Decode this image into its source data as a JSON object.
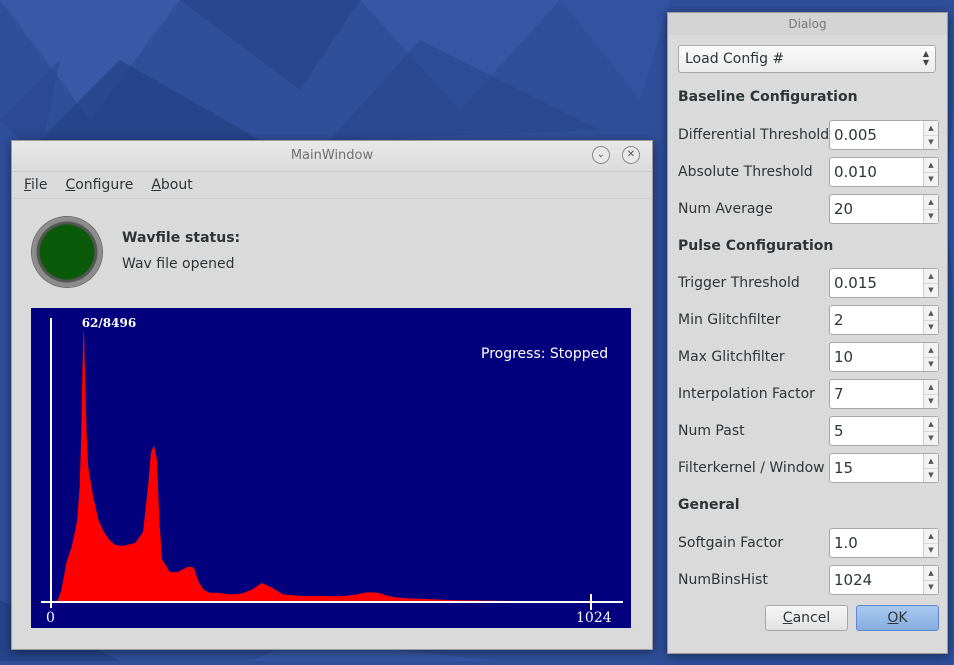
{
  "main_window": {
    "title": "MainWindow",
    "menu": [
      {
        "mnemonic": "F",
        "rest": "ile"
      },
      {
        "mnemonic": "C",
        "rest": "onfigure"
      },
      {
        "mnemonic": "A",
        "rest": "bout"
      }
    ],
    "status_heading": "Wavfile status:",
    "status_text": "Wav file opened",
    "led_color": "#0a5a0a",
    "plot": {
      "background": "#03007e",
      "fill": "#ff0000",
      "peak_label": "62/8496",
      "progress": "Progress: Stopped",
      "x_start_label": "0",
      "x_end_label": "1024"
    }
  },
  "chart_data": {
    "type": "area",
    "title": "",
    "xlabel": "",
    "ylabel": "",
    "xlim": [
      0,
      1024
    ],
    "ylim": [
      0,
      8496
    ],
    "peak": {
      "x": 62,
      "y": 8496
    },
    "x": [
      0,
      12,
      20,
      30,
      40,
      50,
      55,
      58,
      60,
      62,
      64,
      67,
      70,
      80,
      90,
      100,
      110,
      120,
      135,
      160,
      175,
      185,
      190,
      195,
      200,
      205,
      210,
      225,
      240,
      260,
      270,
      280,
      290,
      300,
      315,
      340,
      360,
      380,
      400,
      420,
      440,
      460,
      480,
      500,
      520,
      540,
      560,
      580,
      600,
      620,
      640,
      660,
      680,
      700,
      720,
      740,
      760,
      780,
      800,
      820,
      840,
      860,
      880,
      900,
      920,
      940,
      960,
      980,
      1000,
      1024
    ],
    "y": [
      0,
      0,
      350,
      1250,
      1750,
      2550,
      3650,
      5300,
      7100,
      8496,
      7100,
      5300,
      4250,
      3250,
      2550,
      2200,
      1950,
      1800,
      1750,
      1850,
      2200,
      3700,
      4700,
      4900,
      4500,
      2550,
      1350,
      930,
      930,
      1100,
      1080,
      600,
      370,
      280,
      280,
      230,
      250,
      370,
      590,
      430,
      230,
      200,
      175,
      175,
      180,
      170,
      185,
      230,
      300,
      280,
      175,
      130,
      100,
      90,
      75,
      65,
      50,
      45,
      40,
      35,
      30,
      25,
      20,
      18,
      15,
      12,
      10,
      8,
      5,
      0
    ]
  },
  "dialog": {
    "title": "Dialog",
    "select_value": "Load Config #",
    "sections": {
      "baseline": "Baseline Configuration",
      "pulse": "Pulse Configuration",
      "general": "General"
    },
    "fields": {
      "differential_threshold": {
        "label": "Differential Threshold",
        "value": "0.005"
      },
      "absolute_threshold": {
        "label": "Absolute Threshold",
        "value": "0.010"
      },
      "num_average": {
        "label": "Num Average",
        "value": "20"
      },
      "trigger_threshold": {
        "label": "Trigger Threshold",
        "value": "0.015"
      },
      "min_glitchfilter": {
        "label": "Min Glitchfilter",
        "value": "2"
      },
      "max_glitchfilter": {
        "label": "Max Glitchfilter",
        "value": "10"
      },
      "interpolation_factor": {
        "label": "Interpolation Factor",
        "value": "7"
      },
      "num_past": {
        "label": "Num Past",
        "value": "5"
      },
      "filterkernel_window": {
        "label": "Filterkernel / Window",
        "value": "15"
      },
      "softgain_factor": {
        "label": "Softgain Factor",
        "value": "1.0"
      },
      "numbinshist": {
        "label": "NumBinsHist",
        "value": "1024"
      }
    },
    "cancel": {
      "mnemonic": "C",
      "rest": "ancel"
    },
    "ok": {
      "mnemonic": "O",
      "rest": "K"
    }
  }
}
